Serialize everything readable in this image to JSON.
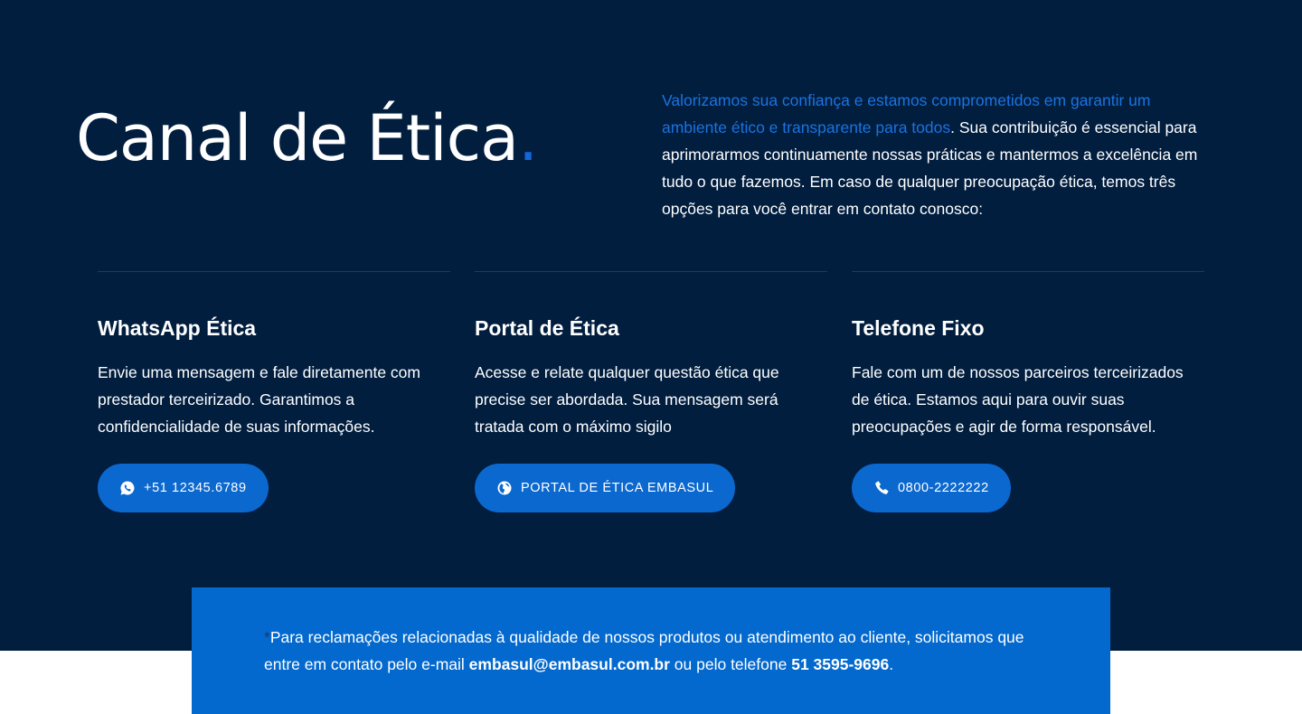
{
  "hero": {
    "title": "Canal de Ética",
    "title_dot": ".",
    "intro_highlight": "Valorizamos sua confiança e estamos comprometidos em garantir um ambiente ético e transparente para todos",
    "intro_rest": ". Sua contribuição é essencial para aprimorarmos continuamente nossas práticas e mantermos a excelência em tudo o que fazemos. Em caso de qualquer preocupação ética, temos três opções para você entrar em contato conosco:"
  },
  "channels": [
    {
      "title": "WhatsApp Ética",
      "text": "Envie uma mensagem e fale diretamente com prestador terceirizado. Garantimos a confidencialidade de suas informações.",
      "button_label": "+51 12345.6789",
      "icon": "whatsapp-icon"
    },
    {
      "title": "Portal de Ética",
      "text": "Acesse e relate qualquer questão ética que precise ser abordada. Sua mensagem será tratada com o máximo sigilo",
      "button_label": "PORTAL DE ÉTICA EMBASUL",
      "icon": "globe-icon"
    },
    {
      "title": "Telefone Fixo",
      "text": "Fale com um de nossos parceiros terceirizados de ética. Estamos aqui para ouvir suas preocupações e agir de forma responsável.",
      "button_label": "0800-2222222",
      "icon": "phone-icon"
    }
  ],
  "notice": {
    "asterisk": "*",
    "text_before": "Para reclamações relacionadas à qualidade de nossos produtos ou atendimento ao cliente, solicitamos que entre em contato pelo e-mail ",
    "email": "embasul@embasul.com.br",
    "text_middle": " ou pelo telefone ",
    "phone": "51 3595-9696",
    "text_end": "."
  },
  "colors": {
    "background": "#011e3f",
    "accent": "#0b68cf",
    "highlight": "#1a73e0",
    "notice_bg": "#0369ce"
  }
}
